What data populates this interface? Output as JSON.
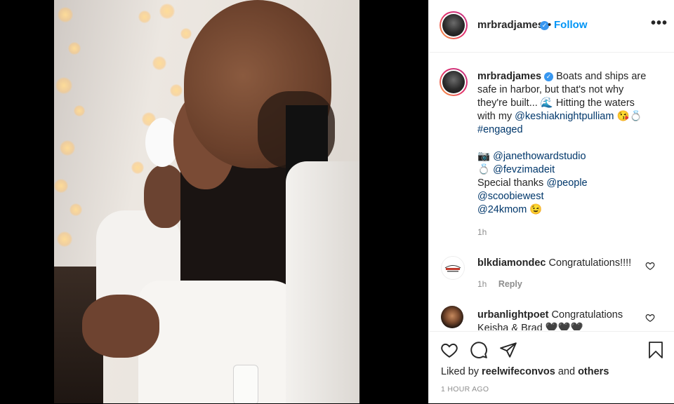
{
  "post": {
    "username": "mrbradjames",
    "follow_label": "Follow",
    "follow_separator": "•",
    "more_label": "•••"
  },
  "caption": {
    "username": "mrbradjames",
    "line1": "Boats and ships are",
    "line2": "safe in harbor, but that's not why",
    "line3a": "they're built... ",
    "wave_emoji": "🌊",
    "line3b": " Hitting the waters",
    "line4a": "with my ",
    "mention1": "@keshiaknightpulliam",
    "emoji_kiss_ring": "😘💍",
    "hashtag": "#engaged",
    "camera_emoji": "📷",
    "mention2": "@janethowardstudio",
    "ring_emoji": "💍",
    "mention3": "@fevzimadeit",
    "thanks_text": "Special thanks ",
    "mention4": "@people",
    "mention5": "@scoobiewest",
    "mention6": "@24kmom",
    "wink_emoji": "😉",
    "time": "1h"
  },
  "comments": [
    {
      "username": "blkdiamondec",
      "text": "Congratulations!!!!",
      "time": "1h",
      "reply_label": "Reply"
    },
    {
      "username": "urbanlightpoet",
      "text": "Congratulations",
      "text2": "Keisha & Brad 🖤🖤🖤"
    }
  ],
  "footer": {
    "liked_prefix": "Liked by ",
    "liked_user": "reelwifeconvos",
    "liked_and": " and ",
    "liked_others": "others",
    "timestamp": "1 HOUR AGO"
  },
  "colors": {
    "accent": "#0095f6",
    "mention": "#00376b",
    "muted": "#8e8e8e",
    "text": "#262626"
  }
}
